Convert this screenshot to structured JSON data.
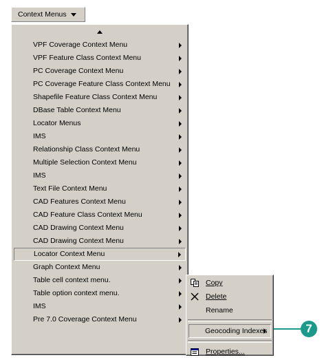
{
  "toolbar": {
    "menu_button_label": "Context Menus"
  },
  "menu": {
    "items": [
      {
        "label": "VPF Coverage Context Menu"
      },
      {
        "label": "VPF Feature Class Context Menu"
      },
      {
        "label": "PC Coverage Context Menu"
      },
      {
        "label": "PC Coverage Feature Class Context Menu"
      },
      {
        "label": "Shapefile Feature Class Context Menu"
      },
      {
        "label": "DBase Table Context Menu"
      },
      {
        "label": "Locator Menus"
      },
      {
        "label": "IMS"
      },
      {
        "label": "Relationship Class Context Menu"
      },
      {
        "label": "Multiple Selection Context Menu"
      },
      {
        "label": "IMS"
      },
      {
        "label": "Text File Context Menu"
      },
      {
        "label": "CAD Features Context Menu"
      },
      {
        "label": "CAD Feature Class Context Menu"
      },
      {
        "label": "CAD Drawing Context Menu"
      },
      {
        "label": "CAD Drawing Context Menu"
      },
      {
        "label": "Locator Context Menu"
      },
      {
        "label": "Graph Context Menu"
      },
      {
        "label": "Table cell context menu."
      },
      {
        "label": "Table option context menu."
      },
      {
        "label": "IMS"
      },
      {
        "label": "Pre 7.0 Coverage Context Menu"
      }
    ]
  },
  "submenu": {
    "copy": {
      "label": "Copy",
      "icon": "copy-icon"
    },
    "delete": {
      "label": "Delete",
      "icon": "delete-x-icon"
    },
    "rename": {
      "label": "Rename"
    },
    "geocoding": {
      "label": "Geocoding Indexes"
    },
    "properties": {
      "label": "Properties...",
      "icon": "properties-icon"
    }
  },
  "callout": {
    "number": "7",
    "color": "#1a9a8a"
  }
}
